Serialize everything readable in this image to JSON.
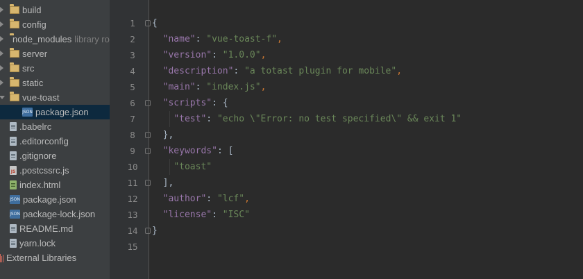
{
  "sidebar": {
    "items": [
      {
        "label": "build",
        "type": "folder",
        "depth": 1,
        "expanded": false
      },
      {
        "label": "config",
        "type": "folder",
        "depth": 1,
        "expanded": false
      },
      {
        "label": "node_modules",
        "type": "folder",
        "depth": 1,
        "expanded": false,
        "suffix": "library root"
      },
      {
        "label": "server",
        "type": "folder",
        "depth": 1,
        "expanded": false
      },
      {
        "label": "src",
        "type": "folder",
        "depth": 1,
        "expanded": false
      },
      {
        "label": "static",
        "type": "folder",
        "depth": 1,
        "expanded": false
      },
      {
        "label": "vue-toast",
        "type": "folder",
        "depth": 1,
        "expanded": true
      },
      {
        "label": "package.json",
        "type": "json",
        "depth": 2,
        "selected": true
      },
      {
        "label": ".babelrc",
        "type": "file",
        "depth": 1
      },
      {
        "label": ".editorconfig",
        "type": "file",
        "depth": 1
      },
      {
        "label": ".gitignore",
        "type": "file",
        "depth": 1
      },
      {
        "label": ".postcssrc.js",
        "type": "js",
        "depth": 1
      },
      {
        "label": "index.html",
        "type": "html",
        "depth": 1
      },
      {
        "label": "package.json",
        "type": "json",
        "depth": 1
      },
      {
        "label": "package-lock.json",
        "type": "json",
        "depth": 1
      },
      {
        "label": "README.md",
        "type": "file",
        "depth": 1
      },
      {
        "label": "yarn.lock",
        "type": "file",
        "depth": 1
      },
      {
        "label": "External Libraries",
        "type": "lib",
        "depth": 0
      }
    ]
  },
  "editor": {
    "line_numbers": [
      "1",
      "2",
      "3",
      "4",
      "5",
      "6",
      "7",
      "8",
      "9",
      "10",
      "11",
      "12",
      "13",
      "14",
      "15"
    ],
    "lines": [
      [
        {
          "t": "{",
          "c": "plain"
        }
      ],
      [
        {
          "t": "  ",
          "c": "plain"
        },
        {
          "t": "\"name\"",
          "c": "key"
        },
        {
          "t": ": ",
          "c": "plain"
        },
        {
          "t": "\"vue-toast-f\"",
          "c": "str"
        },
        {
          "t": ",",
          "c": "punct"
        }
      ],
      [
        {
          "t": "  ",
          "c": "plain"
        },
        {
          "t": "\"version\"",
          "c": "key"
        },
        {
          "t": ": ",
          "c": "plain"
        },
        {
          "t": "\"1.0.0\"",
          "c": "str"
        },
        {
          "t": ",",
          "c": "punct"
        }
      ],
      [
        {
          "t": "  ",
          "c": "plain"
        },
        {
          "t": "\"description\"",
          "c": "key"
        },
        {
          "t": ": ",
          "c": "plain"
        },
        {
          "t": "\"a totast plugin for mobile\"",
          "c": "str"
        },
        {
          "t": ",",
          "c": "punct"
        }
      ],
      [
        {
          "t": "  ",
          "c": "plain"
        },
        {
          "t": "\"main\"",
          "c": "key"
        },
        {
          "t": ": ",
          "c": "plain"
        },
        {
          "t": "\"index.js\"",
          "c": "str"
        },
        {
          "t": ",",
          "c": "punct"
        }
      ],
      [
        {
          "t": "  ",
          "c": "plain"
        },
        {
          "t": "\"scripts\"",
          "c": "key"
        },
        {
          "t": ": {",
          "c": "plain"
        }
      ],
      [
        {
          "t": "    ",
          "c": "plain"
        },
        {
          "t": "\"test\"",
          "c": "key"
        },
        {
          "t": ": ",
          "c": "plain"
        },
        {
          "t": "\"echo \\\"Error: no test specified\\\" && exit 1\"",
          "c": "str"
        }
      ],
      [
        {
          "t": "  },",
          "c": "plain"
        }
      ],
      [
        {
          "t": "  ",
          "c": "plain"
        },
        {
          "t": "\"keywords\"",
          "c": "key"
        },
        {
          "t": ": [",
          "c": "plain"
        }
      ],
      [
        {
          "t": "    ",
          "c": "plain"
        },
        {
          "t": "\"toast\"",
          "c": "str"
        }
      ],
      [
        {
          "t": "  ],",
          "c": "plain"
        }
      ],
      [
        {
          "t": "  ",
          "c": "plain"
        },
        {
          "t": "\"author\"",
          "c": "key"
        },
        {
          "t": ": ",
          "c": "plain"
        },
        {
          "t": "\"lcf\"",
          "c": "str"
        },
        {
          "t": ",",
          "c": "punct"
        }
      ],
      [
        {
          "t": "  ",
          "c": "plain"
        },
        {
          "t": "\"license\"",
          "c": "key"
        },
        {
          "t": ": ",
          "c": "plain"
        },
        {
          "t": "\"ISC\"",
          "c": "str"
        }
      ],
      [
        {
          "t": "}",
          "c": "plain"
        }
      ],
      []
    ],
    "fold_lines": [
      1,
      6,
      8,
      9,
      11,
      14
    ]
  }
}
